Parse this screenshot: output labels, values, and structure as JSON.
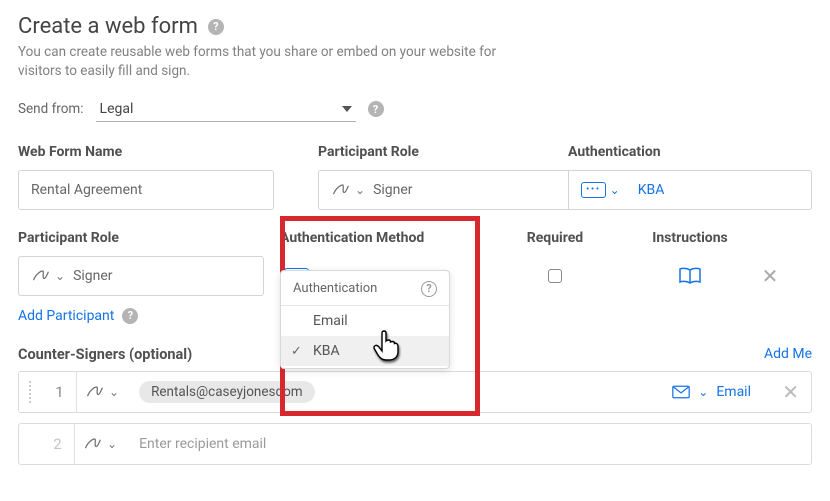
{
  "title": "Create a web form",
  "subtitle": "You can create reusable web forms that you share or embed on your website for visitors to easily fill and sign.",
  "send_from": {
    "label": "Send from:",
    "value": "Legal"
  },
  "labels": {
    "web_form_name": "Web Form Name",
    "participant_role": "Participant Role",
    "authentication": "Authentication",
    "authentication_method": "Authentication Method",
    "required": "Required",
    "instructions": "Instructions"
  },
  "form": {
    "name": "Rental Agreement",
    "role": "Signer",
    "auth": "KBA"
  },
  "second": {
    "role": "Signer",
    "auth": "KBA"
  },
  "dropdown": {
    "heading": "Authentication",
    "items": [
      "Email",
      "KBA"
    ],
    "selected": "KBA"
  },
  "add_participant": "Add Participant",
  "counter_signers": {
    "title": "Counter-Signers (optional)",
    "add_me": "Add Me",
    "rows": [
      {
        "num": "1",
        "chip": "Rentals@caseyjonesdom",
        "auth_label": "Email"
      },
      {
        "num": "2",
        "placeholder": "Enter recipient email"
      }
    ]
  }
}
